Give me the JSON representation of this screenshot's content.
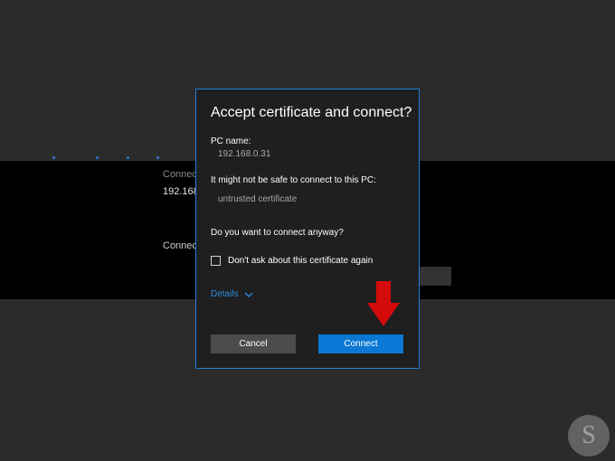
{
  "background": {
    "connect_label_1": "Connect",
    "ip_partial": "192.168.",
    "connect_label_2": "Connect"
  },
  "dialog": {
    "title": "Accept certificate and connect?",
    "pc_name_label": "PC name:",
    "pc_name_value": "192.168.0.31",
    "warning_label": "It might not be safe to connect to this PC:",
    "warning_value": "untrusted certificate",
    "question": "Do you want to connect anyway?",
    "checkbox_label": "Don't ask about this certificate again",
    "checkbox_checked": false,
    "details_label": "Details",
    "cancel_label": "Cancel",
    "connect_label": "Connect"
  },
  "colors": {
    "accent": "#0a78d4",
    "dialog_border": "#1e7fd6",
    "arrow": "#d40b0b"
  },
  "icons": {
    "details_chevron": "chevron-down-icon",
    "annotation_arrow": "arrow-down-icon",
    "watermark": "logo-icon"
  }
}
